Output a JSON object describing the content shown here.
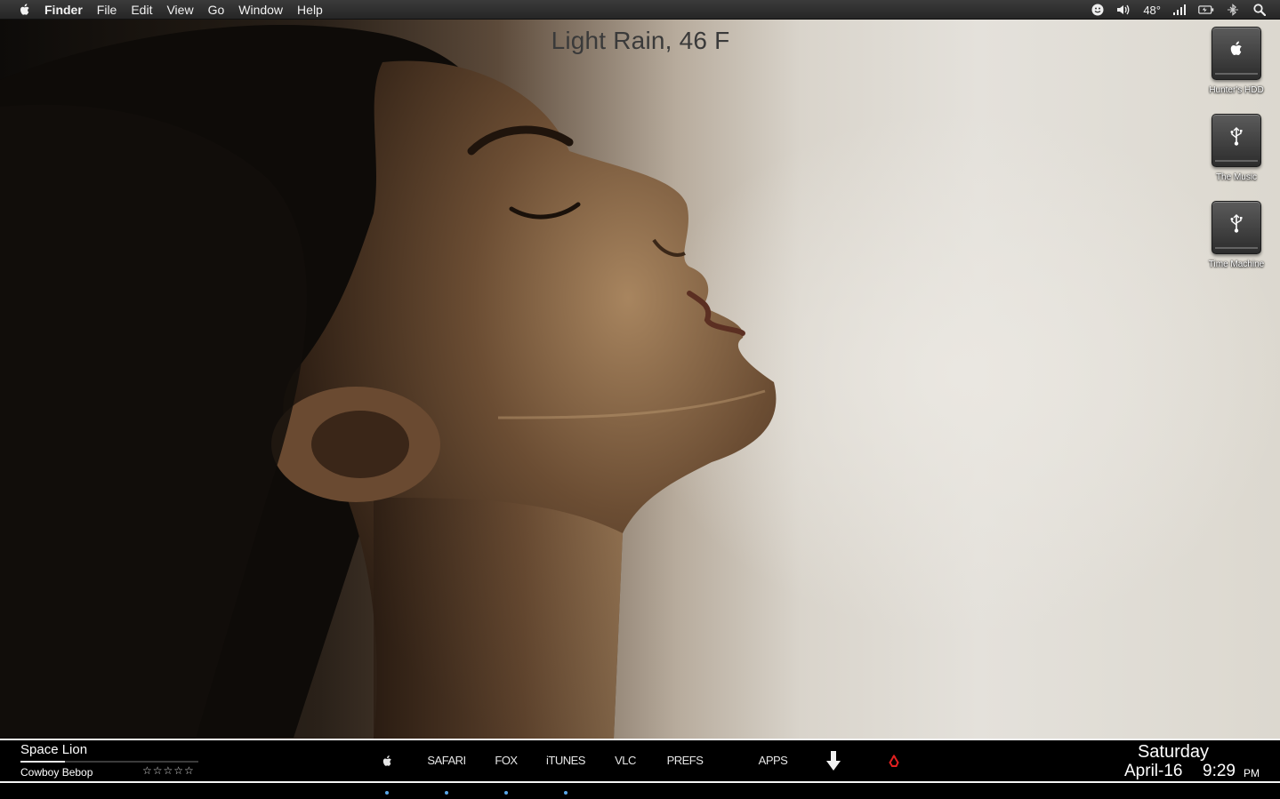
{
  "menubar": {
    "items": [
      "Finder",
      "File",
      "Edit",
      "View",
      "Go",
      "Window",
      "Help"
    ],
    "temperature": "48°"
  },
  "weather": {
    "text": "Light Rain, 46 F"
  },
  "drives": [
    {
      "label": "Hunter's HDD",
      "icon": "apple-icon"
    },
    {
      "label": "The Music",
      "icon": "usb-icon"
    },
    {
      "label": "Time Machine",
      "icon": "usb-icon"
    }
  ],
  "now_playing": {
    "title": "Space Lion",
    "artist": "Cowboy Bebop",
    "rating": "☆☆☆☆☆",
    "progress": 0.25
  },
  "launcher": {
    "items": [
      "SAFARI",
      "FOX",
      "iTUNES",
      "VLC",
      "PREFS",
      "APPS"
    ]
  },
  "clock": {
    "day": "Saturday",
    "date": "April-16",
    "time": "9:29",
    "ampm": "PM"
  },
  "colors": {
    "bar": "#000000",
    "bar_border": "#f4f4f4",
    "dot": "#5aa7e8",
    "trash": "#e02020"
  }
}
